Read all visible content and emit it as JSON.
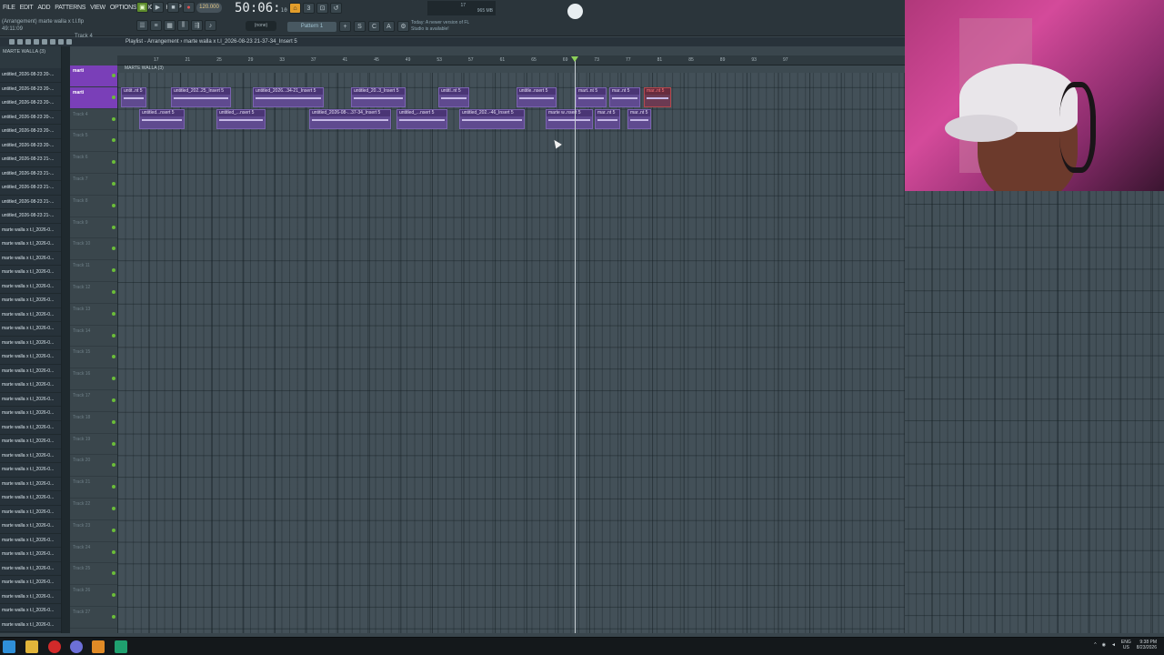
{
  "app": {
    "menu": [
      "FILE",
      "EDIT",
      "ADD",
      "PATTERNS",
      "VIEW",
      "OPTIONS",
      "TOOLS",
      "HELP"
    ],
    "song_info": [
      "(Arrangement)  marte walla x t.l.flp",
      "49:11:09",
      "Track 4"
    ],
    "tempo": "120.000",
    "time": "50:06",
    "time_sub": "10",
    "pattern_selector": "(none)",
    "pattern": "Pattern 1",
    "news": "Today: A newer version of FL Studio is available!",
    "cpu_mem": [
      "17",
      "965 MB",
      "0"
    ]
  },
  "playlist": {
    "title": "Playlist - Arrangement › marte walla x t.l_2026-08-23 21-37-34_Insert 5",
    "ruler_marks": [
      "17",
      "21",
      "25",
      "29",
      "33",
      "37",
      "41",
      "45",
      "49",
      "53",
      "57",
      "61",
      "65",
      "69",
      "73",
      "77",
      "81",
      "85",
      "89",
      "93",
      "97"
    ],
    "marker_label": "MARTE WALLA (3)",
    "tracks": [
      {
        "label": "marti",
        "selected": true
      },
      {
        "label": "marti",
        "selected": true
      },
      {
        "label": "Track 4"
      },
      {
        "label": "Track 5"
      },
      {
        "label": "Track 6"
      },
      {
        "label": "Track 7"
      },
      {
        "label": "Track 8"
      },
      {
        "label": "Track 9"
      },
      {
        "label": "Track 10"
      },
      {
        "label": "Track 11"
      },
      {
        "label": "Track 12"
      },
      {
        "label": "Track 13"
      },
      {
        "label": "Track 14"
      },
      {
        "label": "Track 15"
      },
      {
        "label": "Track 16"
      },
      {
        "label": "Track 17"
      },
      {
        "label": "Track 18"
      },
      {
        "label": "Track 19"
      },
      {
        "label": "Track 20"
      },
      {
        "label": "Track 21"
      },
      {
        "label": "Track 22"
      },
      {
        "label": "Track 23"
      },
      {
        "label": "Track 24"
      },
      {
        "label": "Track 25"
      },
      {
        "label": "Track 26"
      },
      {
        "label": "Track 27"
      }
    ],
    "clips_row1": [
      "untit..nt 5",
      "untitled_202..25_Insert 5",
      "untitled_2026...34-21_Insert 5",
      "untitled_20..3_Insert 5",
      "untitl..nt 5",
      "untitle..nsert 5",
      "mart..nt 5",
      "mar..nt 5",
      "mar..nt 5"
    ],
    "clips_row2": [
      "untitled...nsert 5",
      "untitled_...nsert 5",
      "untitled_2026-08-...37-34_Insert 5",
      "untitled_...nsert 5",
      "untitled_202..-46_Insert 5",
      "marte w..nsert 5",
      "mar..nt 5",
      "mar..nt 5"
    ]
  },
  "browser": {
    "header": "MARTE WALLA (3)",
    "items": [
      "untitled_2026-08-23 20-...",
      "untitled_2026-08-23 20-...",
      "untitled_2026-08-23 20-...",
      "untitled_2026-08-23 20-...",
      "untitled_2026-08-23 20-...",
      "untitled_2026-08-23 20-...",
      "untitled_2026-08-23 21-...",
      "untitled_2026-08-23 21-...",
      "untitled_2026-08-23 21-...",
      "untitled_2026-08-23 21-...",
      "untitled_2026-08-23 21-...",
      "marte walla x t.l_2026-0...",
      "marte walla x t.l_2026-0...",
      "marte walla x t.l_2026-0...",
      "marte walla x t.l_2026-0...",
      "marte walla x t.l_2026-0...",
      "marte walla x t.l_2026-0...",
      "marte walla x t.l_2026-0...",
      "marte walla x t.l_2026-0...",
      "marte walla x t.l_2026-0...",
      "marte walla x t.l_2026-0...",
      "marte walla x t.l_2026-0...",
      "marte walla x t.l_2026-0...",
      "marte walla x t.l_2026-0...",
      "marte walla x t.l_2026-0...",
      "marte walla x t.l_2026-0...",
      "marte walla x t.l_2026-0...",
      "marte walla x t.l_2026-0...",
      "marte walla x t.l_2026-0...",
      "marte walla x t.l_2026-0...",
      "marte walla x t.l_2026-0...",
      "marte walla x t.l_2026-0...",
      "marte walla x t.l_2026-0...",
      "marte walla x t.l_2026-0...",
      "marte walla x t.l_2026-0...",
      "marte walla x t.l_2026-0...",
      "marte walla x t.l_2026-0...",
      "marte walla x t.l_2026-0...",
      "marte walla x t.l_2026-0...",
      "marte walla x t.l_2026-0..."
    ]
  },
  "taskbar": {
    "lang": "ENG",
    "region": "US",
    "time": "9:38 PM",
    "date": "8/23/2026"
  }
}
